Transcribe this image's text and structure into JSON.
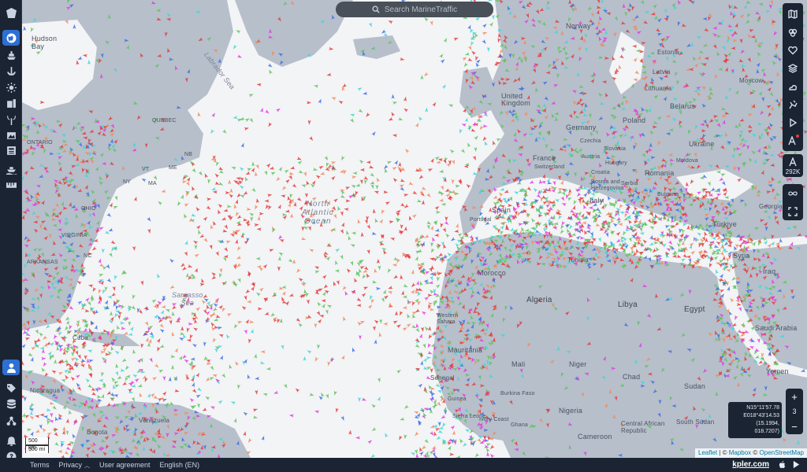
{
  "search": {
    "placeholder": "Search MarineTraffic"
  },
  "sidebar": {
    "items": [
      {
        "icon": "logo-icon"
      },
      {
        "icon": "globe-icon",
        "active": true
      },
      {
        "icon": "ship-icon"
      },
      {
        "icon": "anchor-icon"
      },
      {
        "icon": "sun-icon"
      },
      {
        "icon": "fleet-icon"
      },
      {
        "icon": "antenna-icon"
      },
      {
        "icon": "gallery-icon"
      },
      {
        "icon": "newspaper-icon"
      },
      {
        "icon": "ship-wave-icon"
      },
      {
        "icon": "ruler-icon"
      }
    ],
    "bottom_items": [
      {
        "icon": "user-icon",
        "active": true
      },
      {
        "icon": "tag-icon"
      },
      {
        "icon": "database-icon"
      },
      {
        "icon": "network-icon"
      },
      {
        "icon": "bell-icon"
      },
      {
        "icon": "help-icon"
      }
    ]
  },
  "toolbar": {
    "buttons": [
      "map-layers-icon",
      "filter-icon",
      "heart-icon",
      "layers-icon",
      "weather-icon",
      "measure-icon",
      "play-icon",
      "label-icon"
    ],
    "vessel_count": "292K"
  },
  "map": {
    "labels": {
      "hudson_bay": "Hudson\nBay",
      "labrador_sea": "Labrador Sea",
      "north_atlantic": "North\nAtlantic\nOcean",
      "sargasso": "Sargasso\nSea",
      "ontario": "ONTARIO",
      "quebec": "QUEBEC",
      "norway": "Norway",
      "united_kingdom": "United\nKingdom",
      "germany": "Germany",
      "france": "France",
      "spain": "Spain",
      "portugal": "Portugal",
      "poland": "Poland",
      "belarus": "Belarus",
      "lithuania": "Lithuania",
      "latvia": "Latvia",
      "estonia": "Estonia",
      "ukraine": "Ukraine",
      "moldova": "Moldova",
      "romania": "Romania",
      "hungary": "Hungary",
      "czechia": "Czechia",
      "slovakia": "Slovakia",
      "austria": "Austria",
      "switzerland": "Switzerland",
      "croatia": "Croatia",
      "serbia": "Serbia",
      "bosnia": "Bosnia and\nHerzegovina",
      "bulgaria": "Bulgaria",
      "italy": "Italy",
      "turkiye": "Türkiye",
      "georgia": "Georgia",
      "syria": "Syria",
      "iraq": "Iraq",
      "morocco": "Morocco",
      "algeria": "Algeria",
      "tunisia": "Tunisia",
      "libya": "Libya",
      "egypt": "Egypt",
      "saudi_arabia": "Saudi Arabia",
      "yemen": "Yemen",
      "western_sahara": "Western\nSahara",
      "mauritania": "Mauritania",
      "mali": "Mali",
      "niger": "Niger",
      "chad": "Chad",
      "sudan": "Sudan",
      "senegal": "Senegal",
      "burkina_faso": "Burkina Faso",
      "guinea": "Guinea",
      "sierra_leone": "Sierra Leone",
      "ivory_coast": "Ivory Coast",
      "ghana": "Ghana",
      "nigeria": "Nigeria",
      "cameroon": "Cameroon",
      "central_african_republic": "Central African\nRepublic",
      "south_sudan": "South Sudan",
      "cuba": "Cuba",
      "nicaragua": "Nicaragua",
      "venezuela": "Venezuela",
      "bogota": "Bogota",
      "moscow": "Moscow",
      "virginia": "VIRGINIA",
      "arkansas": "ARKANSAS",
      "ohio": "OHIO",
      "nb": "NB",
      "me": "ME",
      "vt": "VT",
      "ma": "MA",
      "ny": "NY",
      "nc": "NC"
    }
  },
  "zoom": {
    "plus": "+",
    "level": "3",
    "minus": "−"
  },
  "coords": {
    "lat": "N15°11'57.78",
    "lon": "E018°43'14.53",
    "dec": "(15.1994, 018.7207)"
  },
  "scale": {
    "km": "500 km",
    "mi": "300 mi"
  },
  "attribution": {
    "leaflet": "Leaflet",
    "sep1": " | © ",
    "mapbox": "Mapbox",
    "sep2": " © ",
    "osm": "OpenStreetMap"
  },
  "footer": {
    "links": [
      "Terms",
      "Privacy",
      "User agreement",
      "English (EN)"
    ],
    "brand": "kpler.com"
  },
  "colors": {
    "land": "#b7bfcb",
    "ocean": "#f3f4f6",
    "sidebar": "#1b2433",
    "accent": "#2e6fd4",
    "cargo": "#5fc25f",
    "tanker": "#e23b3b",
    "passenger": "#3d6fe0",
    "fishing": "#f08a5d",
    "highspeed": "#e23be0",
    "tug": "#3fd6d6"
  }
}
